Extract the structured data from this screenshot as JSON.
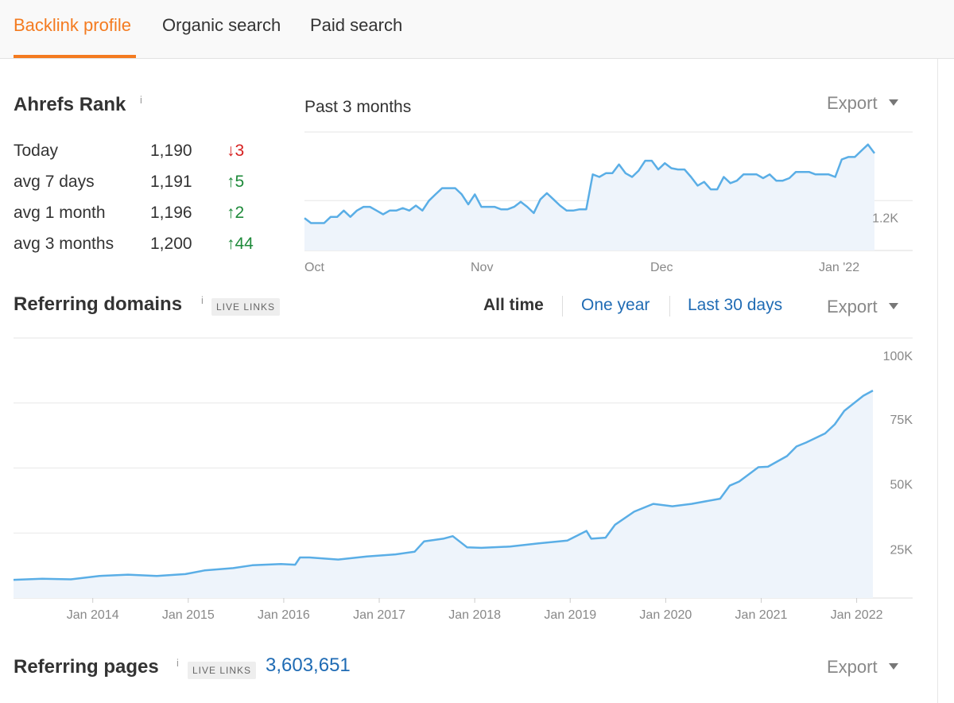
{
  "tabs": [
    {
      "label": "Backlink profile",
      "active": true
    },
    {
      "label": "Organic search",
      "active": false
    },
    {
      "label": "Paid search",
      "active": false
    }
  ],
  "colors": {
    "accent": "#f47b20",
    "line": "#5aaee6",
    "fill": "#eef4fb",
    "up": "#1e8a3a",
    "down": "#d62020",
    "link": "#1f6bb4"
  },
  "ahrefs_rank": {
    "title": "Ahrefs Rank",
    "info": "i",
    "period": "Past 3 months",
    "export_label": "Export",
    "rows": [
      {
        "label": "Today",
        "value": "1,190",
        "change": "3",
        "direction": "down",
        "arrow": "↓"
      },
      {
        "label": "avg 7 days",
        "value": "1,191",
        "change": "5",
        "direction": "up",
        "arrow": "↑"
      },
      {
        "label": "avg 1 month",
        "value": "1,196",
        "change": "2",
        "direction": "up",
        "arrow": "↑"
      },
      {
        "label": "avg 3 months",
        "value": "1,200",
        "change": "44",
        "direction": "up",
        "arrow": "↑"
      }
    ]
  },
  "referring_domains": {
    "title": "Referring domains",
    "info": "i",
    "badge": "LIVE LINKS",
    "ranges": [
      {
        "label": "All time",
        "active": true
      },
      {
        "label": "One year",
        "active": false
      },
      {
        "label": "Last 30 days",
        "active": false
      }
    ],
    "export_label": "Export"
  },
  "referring_pages": {
    "title": "Referring pages",
    "info": "i",
    "badge": "LIVE LINKS",
    "value": "3,603,651",
    "export_label": "Export"
  },
  "chart_data": [
    {
      "type": "area",
      "title": "",
      "x_ticks": [
        "Oct",
        "Nov",
        "Dec",
        "Jan '22"
      ],
      "y_ticks": [
        "1.2K"
      ],
      "ylim": [
        1160,
        1255
      ],
      "grid": true,
      "series": [
        {
          "values": [
            1186,
            1182,
            1182,
            1182,
            1187,
            1187,
            1192,
            1187,
            1192,
            1195,
            1195,
            1192,
            1189,
            1192,
            1192,
            1194,
            1192,
            1196,
            1192,
            1200,
            1205,
            1210,
            1210,
            1210,
            1205,
            1197,
            1205,
            1195,
            1195,
            1195,
            1193,
            1193,
            1195,
            1199,
            1195,
            1190,
            1201,
            1206,
            1201,
            1196,
            1192,
            1192,
            1193,
            1193,
            1221,
            1219,
            1222,
            1222,
            1229,
            1222,
            1219,
            1224,
            1232,
            1232,
            1225,
            1230,
            1226,
            1225,
            1225,
            1219,
            1212,
            1215,
            1209,
            1209,
            1219,
            1214,
            1216,
            1221,
            1221,
            1221,
            1218,
            1221,
            1216,
            1216,
            1218,
            1223,
            1223,
            1223,
            1221,
            1221,
            1221,
            1219,
            1233,
            1235,
            1235,
            1240,
            1245,
            1238
          ]
        }
      ]
    },
    {
      "type": "area",
      "title": "",
      "x_ticks": [
        "Jan 2014",
        "Jan 2015",
        "Jan 2016",
        "Jan 2017",
        "Jan 2018",
        "Jan 2019",
        "Jan 2020",
        "Jan 2021",
        "Jan 2022"
      ],
      "y_ticks": [
        "25K",
        "50K",
        "75K",
        "100K"
      ],
      "ylim": [
        0,
        100000
      ],
      "grid": true,
      "series": [
        {
          "x": [
            2013.0,
            2013.3,
            2013.6,
            2013.9,
            2014.2,
            2014.5,
            2014.8,
            2015.0,
            2015.3,
            2015.5,
            2015.8,
            2015.95,
            2016.0,
            2016.1,
            2016.4,
            2016.7,
            2017.0,
            2017.2,
            2017.3,
            2017.5,
            2017.6,
            2017.75,
            2017.9,
            2018.2,
            2018.5,
            2018.8,
            2019.0,
            2019.05,
            2019.2,
            2019.3,
            2019.5,
            2019.7,
            2019.9,
            2020.1,
            2020.4,
            2020.5,
            2020.6,
            2020.8,
            2020.9,
            2021.1,
            2021.2,
            2021.3,
            2021.5,
            2021.6,
            2021.7,
            2021.9,
            2022.0
          ],
          "values": [
            7000,
            7400,
            7200,
            8500,
            9000,
            8500,
            9200,
            10600,
            11500,
            12600,
            13100,
            12800,
            15600,
            15600,
            14800,
            16000,
            16800,
            17800,
            21800,
            22800,
            23800,
            19500,
            19300,
            19800,
            21000,
            22100,
            25800,
            22800,
            23200,
            28200,
            33200,
            36200,
            35300,
            36200,
            38200,
            43200,
            44800,
            50300,
            50500,
            54600,
            58300,
            59800,
            63300,
            66800,
            72000,
            77800,
            79800
          ]
        }
      ]
    }
  ]
}
